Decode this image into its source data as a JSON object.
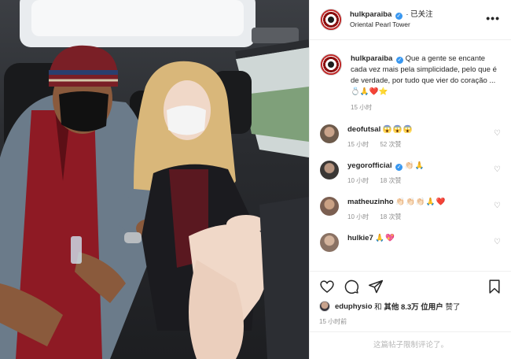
{
  "header": {
    "username": "hulkparaiba",
    "follow_status": "· 已关注",
    "location": "Oriental Pearl Tower",
    "more": "•••"
  },
  "caption": {
    "username": "hulkparaiba",
    "text": "Que a gente se encante cada vez mais pela simplicidade, pelo que é de verdade, por tudo que vier do coração ... 💍🙏❤️⭐",
    "time": "15 小时"
  },
  "comments": [
    {
      "username": "deofutsal",
      "text": "😱😱😱",
      "time": "15 小时",
      "likes": "52 次赞",
      "verified": false,
      "face_color": "#6d5a4b"
    },
    {
      "username": "yegorofficial",
      "text": "👏🏻🙏",
      "time": "10 小时",
      "likes": "18 次赞",
      "verified": true,
      "face_color": "#4f4b48"
    },
    {
      "username": "matheuzinho",
      "text": "👏🏻👏🏻👏🏻🙏❤️",
      "time": "10 小时",
      "likes": "18 次赞",
      "verified": false,
      "face_color": "#7b5f51"
    },
    {
      "username": "hulkie7",
      "text": "🙏💖",
      "time": "",
      "likes": "",
      "verified": false,
      "face_color": "#8a7264"
    }
  ],
  "likes": {
    "liker": "eduphysio",
    "connector": "和",
    "others": "其他 8.3万 位用户",
    "suffix": "赞了"
  },
  "post_time": "15 小时前",
  "footer": "这篇帖子限制评论了。",
  "colors": {
    "accent": "#3897f0",
    "muted": "#8e8e8e",
    "heart": "#ed4956"
  }
}
